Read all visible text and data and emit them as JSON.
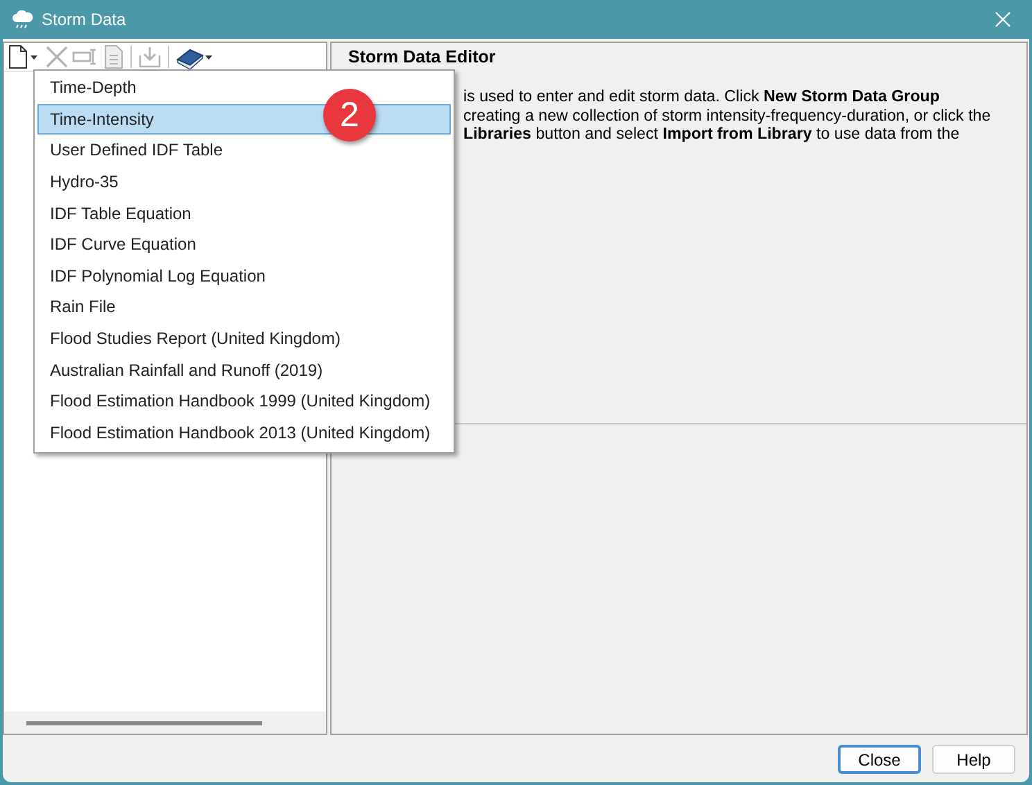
{
  "window": {
    "title": "Storm Data"
  },
  "toolbar": [
    {
      "kind": "new",
      "disabled": false
    },
    {
      "kind": "delete",
      "disabled": true
    },
    {
      "kind": "rename",
      "disabled": true
    },
    {
      "kind": "document",
      "disabled": true
    },
    {
      "kind": "separator"
    },
    {
      "kind": "import",
      "disabled": true
    },
    {
      "kind": "separator"
    },
    {
      "kind": "library",
      "disabled": false
    }
  ],
  "editor": {
    "title": "Storm Data Editor",
    "description_lines": [
      "is used to enter and edit storm data.  Click **New Storm Data Group**",
      "creating a new collection of storm intensity-frequency-duration, or click the",
      "**Libraries** button and select **Import from Library** to use data from the"
    ]
  },
  "menu": {
    "items": [
      {
        "label": "Time-Depth",
        "selected": false
      },
      {
        "label": "Time-Intensity",
        "selected": true
      },
      {
        "label": "User Defined IDF Table",
        "selected": false
      },
      {
        "label": "Hydro-35",
        "selected": false
      },
      {
        "label": "IDF Table Equation",
        "selected": false
      },
      {
        "label": "IDF Curve Equation",
        "selected": false
      },
      {
        "label": "IDF Polynomial Log Equation",
        "selected": false
      },
      {
        "label": "Rain File",
        "selected": false
      },
      {
        "label": "Flood Studies Report (United Kingdom)",
        "selected": false
      },
      {
        "label": "Australian Rainfall and Runoff (2019)",
        "selected": false
      },
      {
        "label": "Flood Estimation Handbook 1999 (United Kingdom)",
        "selected": false
      },
      {
        "label": "Flood Estimation Handbook 2013 (United Kingdom)",
        "selected": false
      }
    ]
  },
  "badge": "2",
  "buttons": [
    {
      "label": "Close",
      "default": true
    },
    {
      "label": "Help",
      "default": false
    }
  ]
}
